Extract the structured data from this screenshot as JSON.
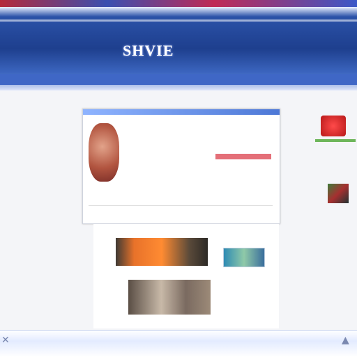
{
  "header": {
    "brand": "SHVIE",
    "left_lines": [
      "",
      "",
      ""
    ],
    "right_text": "",
    "nav": [
      "",
      "",
      "",
      "",
      "",
      ""
    ]
  },
  "left": {
    "lines": [
      "",
      ""
    ],
    "heading": ""
  },
  "card": {
    "title": "",
    "row1": "",
    "row2": "",
    "price": "",
    "red_text": "",
    "footer": ""
  },
  "captions": {
    "left": "",
    "right": ""
  },
  "footer": {
    "text": ""
  },
  "colors": {
    "header_blue": "#1e3f8e",
    "accent_red": "#c8283c"
  },
  "icons": {
    "footer_left": "close-icon",
    "footer_right": "scroll-icon"
  }
}
